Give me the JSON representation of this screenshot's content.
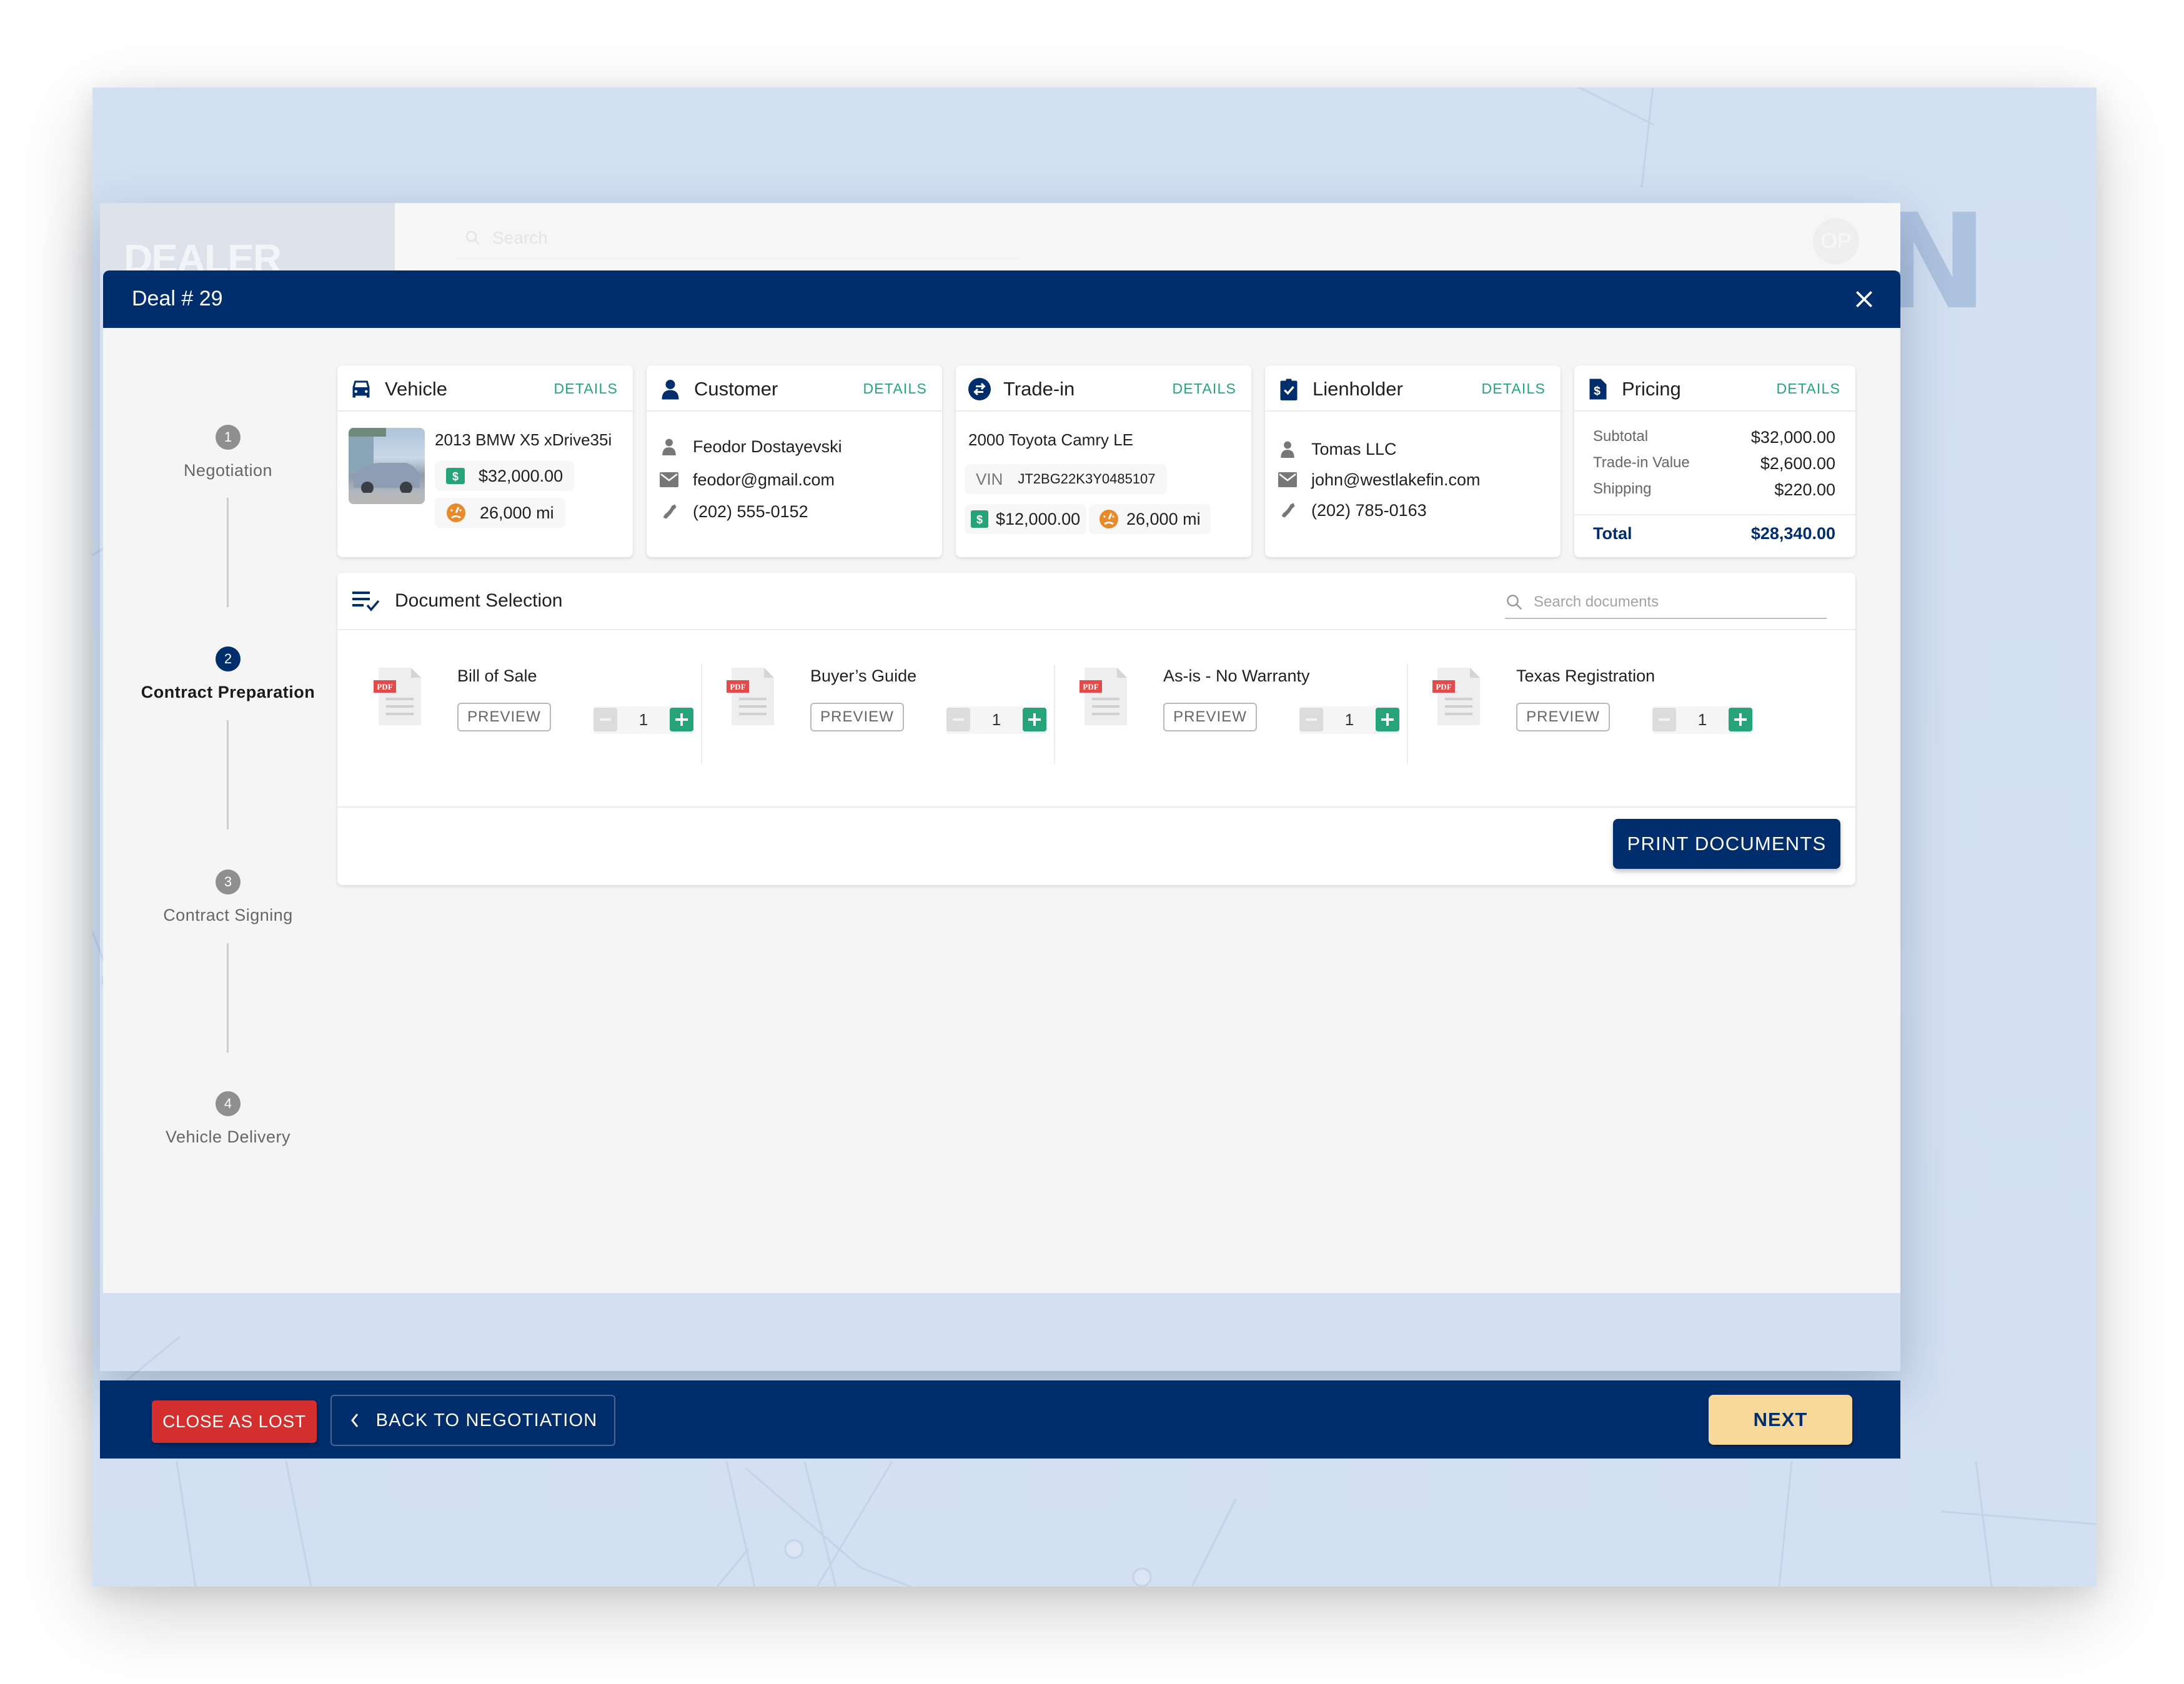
{
  "background": {
    "watermark": "CONTRACT PREPARATION",
    "app_logo": "DEALER",
    "search_placeholder": "Search",
    "avatar_initials": "OP"
  },
  "modal": {
    "title": "Deal # 29",
    "close_icon": "close-icon"
  },
  "stepper": {
    "current": 2,
    "steps": [
      {
        "number": "1",
        "label": "Negotiation"
      },
      {
        "number": "2",
        "label": "Contract Preparation"
      },
      {
        "number": "3",
        "label": "Contract Signing"
      },
      {
        "number": "4",
        "label": "Vehicle Delivery"
      }
    ]
  },
  "cards": {
    "details_label": "DETAILS",
    "vehicle": {
      "title": "Vehicle",
      "icon": "car-icon",
      "name": "2013 BMW X5 xDrive35i",
      "price": "$32,000.00",
      "mileage": "26,000 mi"
    },
    "customer": {
      "title": "Customer",
      "icon": "person-icon",
      "name": "Feodor Dostayevski",
      "email": "feodor@gmail.com",
      "phone": "(202) 555-0152"
    },
    "tradein": {
      "title": "Trade-in",
      "icon": "swap-icon",
      "name": "2000 Toyota Camry LE",
      "vin_label": "VIN",
      "vin": "JT2BG22K3Y0485107",
      "price": "$12,000.00",
      "mileage": "26,000 mi"
    },
    "lienholder": {
      "title": "Lienholder",
      "icon": "clipboard-check-icon",
      "name": "Tomas LLC",
      "email": "john@westlakefin.com",
      "phone": "(202) 785-0163"
    },
    "pricing": {
      "title": "Pricing",
      "icon": "invoice-dollar-icon",
      "rows": [
        {
          "label": "Subtotal",
          "value": "$32,000.00"
        },
        {
          "label": "Trade-in Value",
          "value": "$2,600.00"
        },
        {
          "label": "Shipping",
          "value": "$220.00"
        }
      ],
      "total_label": "Total",
      "total_value": "$28,340.00"
    }
  },
  "documents": {
    "title": "Document Selection",
    "search_placeholder": "Search documents",
    "preview_label": "PREVIEW",
    "items": [
      {
        "name": "Bill of Sale",
        "qty": "1"
      },
      {
        "name": "Buyer’s Guide",
        "qty": "1"
      },
      {
        "name": "As-is - No Warranty",
        "qty": "1"
      },
      {
        "name": "Texas Registration",
        "qty": "1"
      }
    ],
    "print_label": "PRINT DOCUMENTS"
  },
  "footer": {
    "close_lost_label": "CLOSE AS LOST",
    "back_label": "BACK TO NEGOTIATION",
    "next_label": "NEXT"
  },
  "colors": {
    "primary": "#002d6b",
    "accent_green": "#27a37a",
    "danger": "#d32f2f",
    "next_bg": "#f9d99a",
    "mileage_orange": "#e8892a"
  }
}
